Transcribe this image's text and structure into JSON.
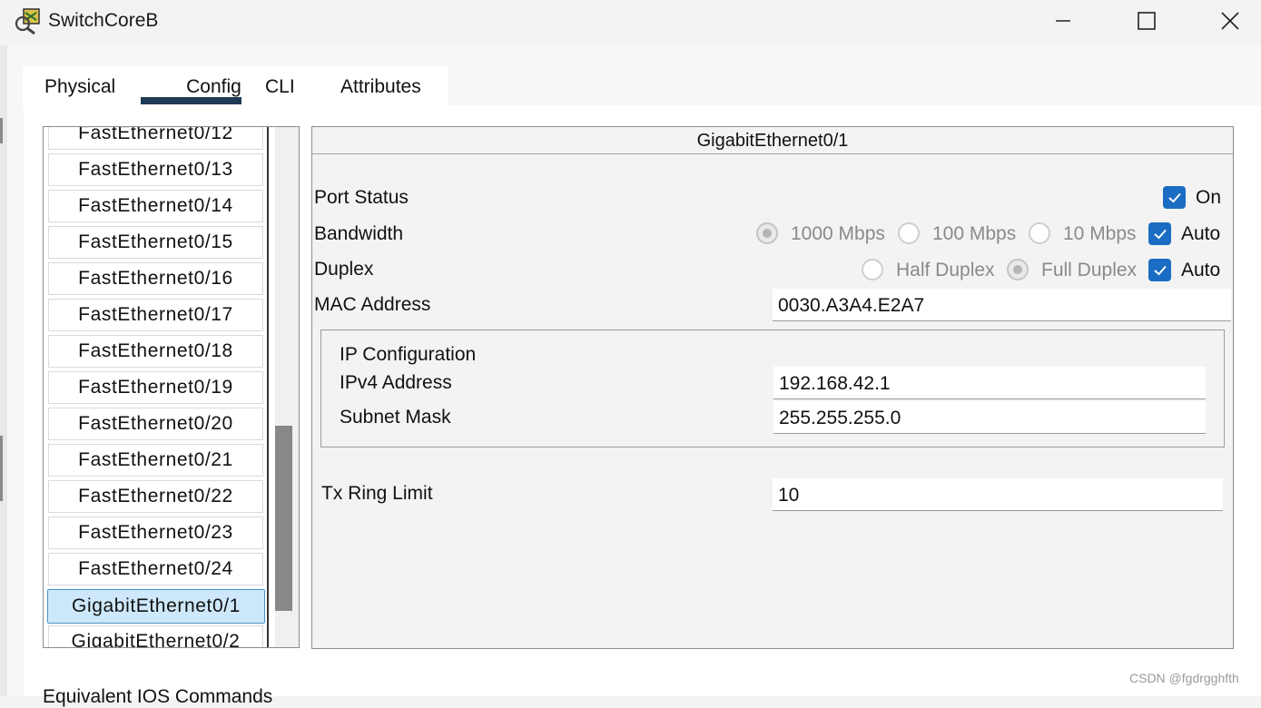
{
  "window": {
    "title": "SwitchCoreB",
    "icons": {
      "app": "switch-app-icon",
      "minimize": "minimize-icon",
      "maximize": "maximize-icon",
      "close": "close-icon"
    }
  },
  "tabs": [
    {
      "label": "Physical",
      "active": false
    },
    {
      "label": "Config",
      "active": true
    },
    {
      "label": "CLI",
      "active": false
    },
    {
      "label": "Attributes",
      "active": false
    }
  ],
  "interface_list": {
    "items": [
      "FastEthernet0/12",
      "FastEthernet0/13",
      "FastEthernet0/14",
      "FastEthernet0/15",
      "FastEthernet0/16",
      "FastEthernet0/17",
      "FastEthernet0/18",
      "FastEthernet0/19",
      "FastEthernet0/20",
      "FastEthernet0/21",
      "FastEthernet0/22",
      "FastEthernet0/23",
      "FastEthernet0/24",
      "GigabitEthernet0/1",
      "GigabitEthernet0/2"
    ],
    "selected": "GigabitEthernet0/1"
  },
  "panel": {
    "title": "GigabitEthernet0/1",
    "port_status": {
      "label": "Port Status",
      "on_label": "On",
      "checked": true
    },
    "bandwidth": {
      "label": "Bandwidth",
      "options": [
        "1000 Mbps",
        "100 Mbps",
        "10 Mbps"
      ],
      "selected": "1000 Mbps",
      "auto_label": "Auto",
      "auto_checked": true
    },
    "duplex": {
      "label": "Duplex",
      "options": [
        "Half Duplex",
        "Full Duplex"
      ],
      "selected": "Full Duplex",
      "auto_label": "Auto",
      "auto_checked": true
    },
    "mac": {
      "label": "MAC Address",
      "value": "0030.A3A4.E2A7"
    },
    "ip_config": {
      "title": "IP Configuration",
      "ipv4_label": "IPv4 Address",
      "ipv4_value": "192.168.42.1",
      "subnet_label": "Subnet Mask",
      "subnet_value": "255.255.255.0"
    },
    "tx_ring": {
      "label": "Tx Ring Limit",
      "value": "10"
    }
  },
  "footer": {
    "partial_text": "Equivalent IOS Commands"
  },
  "watermark": "CSDN @fgdrgghfth",
  "colors": {
    "accent": "#1a6dc2",
    "selection": "#cde8fa",
    "tab_underline": "#1e3a57"
  }
}
